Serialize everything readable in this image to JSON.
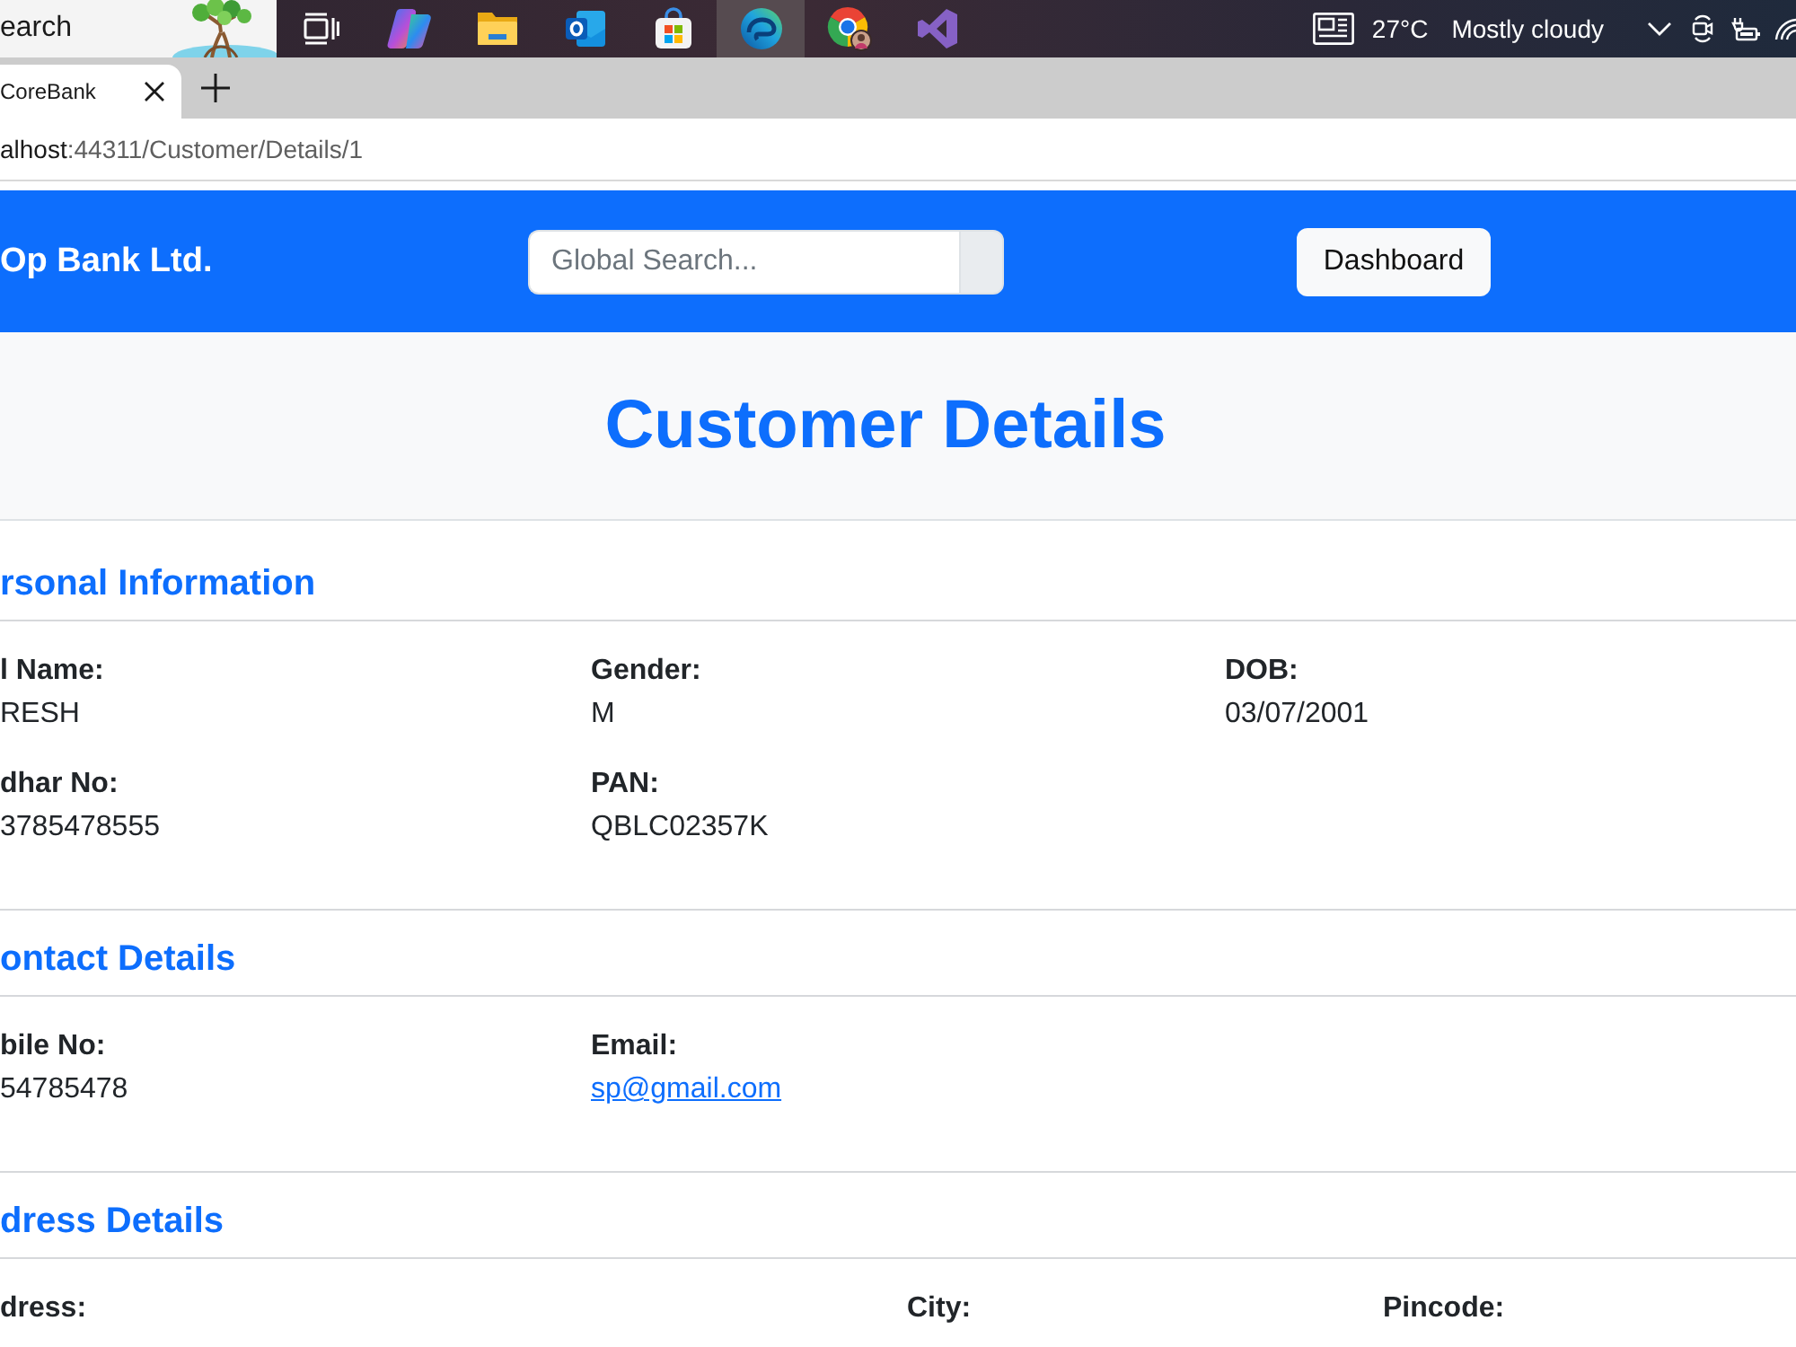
{
  "taskbar": {
    "search": {
      "placeholder": "earch"
    },
    "apps": [
      {
        "kind": "taskview",
        "selected": false
      },
      {
        "kind": "assistant",
        "selected": false
      },
      {
        "kind": "files",
        "selected": false
      },
      {
        "kind": "mail",
        "selected": false
      },
      {
        "kind": "store",
        "selected": false
      },
      {
        "kind": "browser",
        "selected": true
      },
      {
        "kind": "webapp",
        "selected": false
      },
      {
        "kind": "ide",
        "selected": false
      }
    ],
    "weather": {
      "temperature": "27°C",
      "condition": "Mostly cloudy"
    }
  },
  "browser": {
    "tabs": [
      {
        "title": "CoreBank",
        "selected": true
      }
    ],
    "address": {
      "host": "alhost",
      "path": ":44311/Customer/Details/1"
    }
  },
  "navbar": {
    "brand": "Op Bank Ltd.",
    "search": {
      "placeholder": "Global Search..."
    },
    "button": "Dashboard"
  },
  "page_title": "Customer Details",
  "sections": [
    {
      "kind": "details",
      "title": "rsonal Information",
      "fields": [
        {
          "label": "l Name:",
          "value": "RESH",
          "kind": "text"
        },
        {
          "label": "Gender:",
          "value": "M",
          "kind": "text"
        },
        {
          "label": "DOB:",
          "value": "03/07/2001",
          "kind": "text"
        },
        {
          "label": "dhar No:",
          "value": "3785478555",
          "kind": "text"
        },
        {
          "label": "PAN:",
          "value": "QBLC02357K",
          "kind": "text"
        }
      ]
    },
    {
      "kind": "details",
      "title": "ontact Details",
      "fields": [
        {
          "label": "bile No:",
          "value": "54785478",
          "kind": "text"
        },
        {
          "label": "Email:",
          "value": "sp@gmail.com",
          "kind": "link"
        }
      ]
    },
    {
      "kind": "address",
      "title": "dress Details",
      "fields": [
        {
          "label": "dress:"
        },
        {
          "label": "City:"
        },
        {
          "label": "Pincode:"
        }
      ]
    }
  ]
}
